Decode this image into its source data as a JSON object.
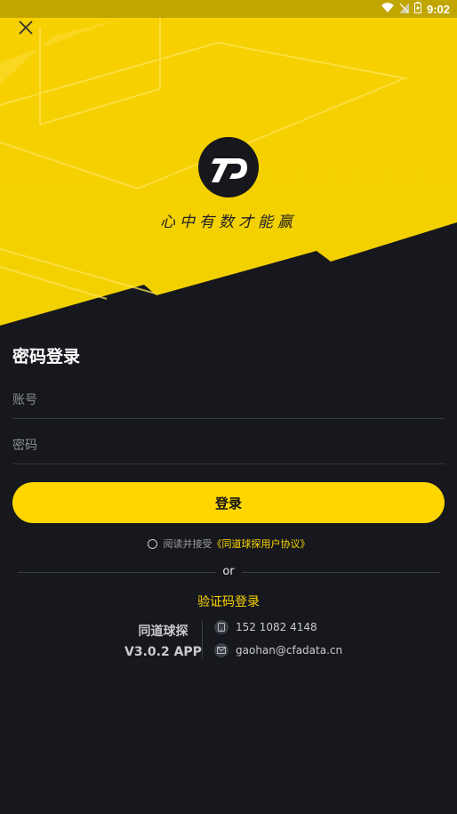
{
  "status_bar": {
    "time": "9:02"
  },
  "header": {
    "slogan": "心中有数才能赢"
  },
  "login": {
    "title": "密码登录",
    "account_placeholder": "账号",
    "password_placeholder": "密码",
    "submit_label": "登录"
  },
  "agreement": {
    "prefix": "阅读并接受",
    "link": "《同道球探用户协议》"
  },
  "divider_text": "or",
  "alt_login": "验证码登录",
  "app": {
    "name": "同道球探",
    "version": "V3.0.2 APP"
  },
  "contact": {
    "phone": "152 1082 4148",
    "email": "gaohan@cfadata.cn"
  },
  "colors": {
    "accent": "#ffd600",
    "background": "#16181d"
  }
}
